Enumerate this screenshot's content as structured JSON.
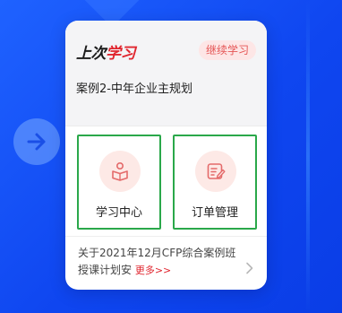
{
  "card": {
    "logo_black": "上次",
    "logo_red": "学习",
    "continue_label": "继续学习",
    "course_title": "案例2-中年企业主规划"
  },
  "tiles": [
    {
      "label": "学习中心",
      "icon": "reader-icon"
    },
    {
      "label": "订单管理",
      "icon": "edit-document-icon"
    }
  ],
  "news": {
    "text": "关于2021年12月CFP综合案例班授课计划安",
    "more_label": "更多>>"
  },
  "colors": {
    "accent_red": "#e0252e",
    "pill_bg": "#fde6e6",
    "highlight_green": "#2aa84a",
    "background_blue": "#1547f2"
  }
}
